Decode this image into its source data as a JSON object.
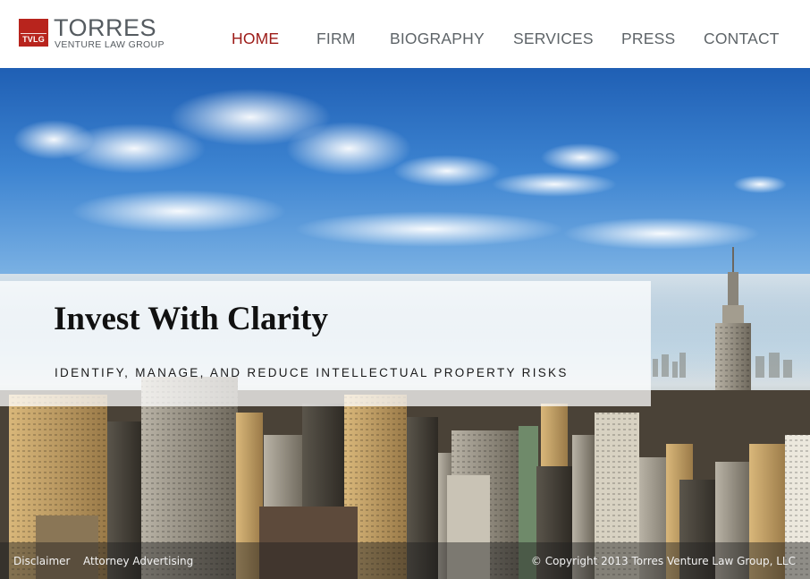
{
  "brand": {
    "badge": "TVLG",
    "name": "TORRES",
    "subtitle": "VENTURE LAW GROUP",
    "accent_color": "#b8241d"
  },
  "nav": {
    "items": [
      {
        "label": "HOME",
        "active": true
      },
      {
        "label": "FIRM",
        "active": false
      },
      {
        "label": "BIOGRAPHY",
        "active": false
      },
      {
        "label": "SERVICES",
        "active": false
      },
      {
        "label": "PRESS",
        "active": false
      },
      {
        "label": "CONTACT",
        "active": false
      }
    ],
    "active_color": "#9c1a17",
    "text_color": "#5e6468"
  },
  "hero": {
    "title": "Invest With Clarity",
    "subtitle": "IDENTIFY, MANAGE, AND REDUCE INTELLECTUAL PROPERTY RISKS",
    "background": "new-york-skyline-photo"
  },
  "footer": {
    "disclaimer": "Disclaimer",
    "advertising": "Attorney Advertising",
    "copyright": "© Copyright 2013 Torres Venture Law Group, LLC"
  }
}
